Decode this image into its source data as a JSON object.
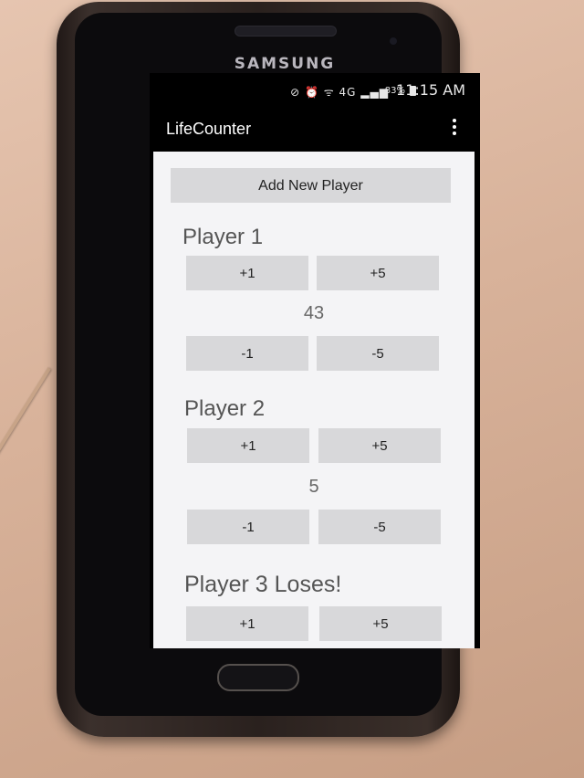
{
  "device": {
    "brand": "SAMSUNG"
  },
  "status_bar": {
    "icons": "⊘ ⏰ ᯤ 4G ▂▄▆",
    "battery": "83%",
    "time": "11:15 AM"
  },
  "app": {
    "title": "LifeCounter"
  },
  "add_player_label": "Add New Player",
  "players": [
    {
      "name": "Player 1",
      "life": "43",
      "plus1": "+1",
      "plus5": "+5",
      "minus1": "-1",
      "minus5": "-5"
    },
    {
      "name": "Player 2",
      "life": "5",
      "plus1": "+1",
      "plus5": "+5",
      "minus1": "-1",
      "minus5": "-5"
    },
    {
      "name": "Player 3 Loses!",
      "plus1": "+1",
      "plus5": "+5"
    }
  ]
}
